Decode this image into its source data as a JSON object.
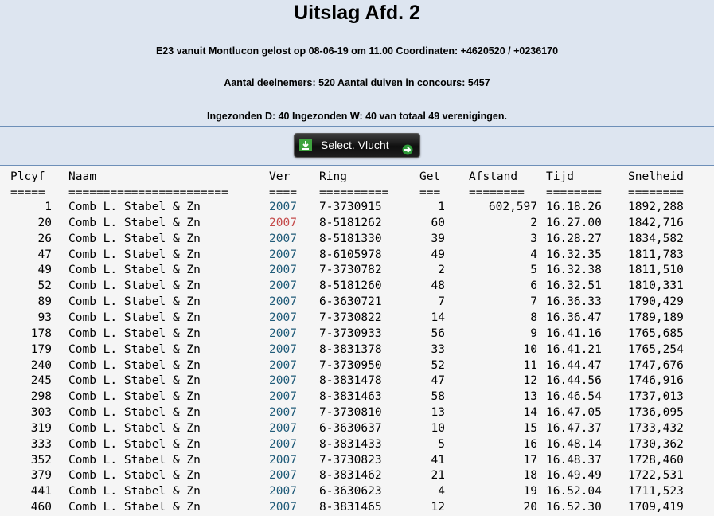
{
  "header": {
    "title": "Uitslag Afd. 2",
    "line1": "E23 vanuit Montlucon gelost op 08-06-19 om 11.00 Coordinaten: +4620520 / +0236170",
    "line2": "Aantal deelnemers: 520 Aantal duiven in concours: 5457",
    "line3": "Ingezonden D: 40 Ingezonden W: 40 van totaal 49 verenigingen."
  },
  "toolbar": {
    "select_label": "Select. Vlucht",
    "left_icon": "download-icon",
    "right_icon": "arrow-right-icon"
  },
  "table": {
    "headers": [
      "Plcyf",
      "Naam",
      "Ver",
      "Ring",
      "Get",
      "Afstand",
      "Tijd",
      "Snelheid"
    ],
    "separators": [
      "=====",
      "=======================",
      "====",
      "==========",
      "===",
      "========",
      "========",
      "========"
    ],
    "rows": [
      {
        "plcyf": "1",
        "naam": "Comb L. Stabel & Zn",
        "ver": "2007",
        "ring": "7-3730915",
        "get": "1",
        "afstand": "602,597",
        "tijd": "16.18.26",
        "snelheid": "1892,288",
        "ver_color": "#1e5a78"
      },
      {
        "plcyf": "20",
        "naam": "Comb L. Stabel & Zn",
        "ver": "2007",
        "ring": "8-5181262",
        "get": "60",
        "afstand": "2",
        "tijd": "16.27.00",
        "snelheid": "1842,716",
        "ver_color": "#c44a4a"
      },
      {
        "plcyf": "26",
        "naam": "Comb L. Stabel & Zn",
        "ver": "2007",
        "ring": "8-5181330",
        "get": "39",
        "afstand": "3",
        "tijd": "16.28.27",
        "snelheid": "1834,582",
        "ver_color": "#1e5a78"
      },
      {
        "plcyf": "47",
        "naam": "Comb L. Stabel & Zn",
        "ver": "2007",
        "ring": "8-6105978",
        "get": "49",
        "afstand": "4",
        "tijd": "16.32.35",
        "snelheid": "1811,783",
        "ver_color": "#1e5a78"
      },
      {
        "plcyf": "49",
        "naam": "Comb L. Stabel & Zn",
        "ver": "2007",
        "ring": "7-3730782",
        "get": "2",
        "afstand": "5",
        "tijd": "16.32.38",
        "snelheid": "1811,510",
        "ver_color": "#1e5a78"
      },
      {
        "plcyf": "52",
        "naam": "Comb L. Stabel & Zn",
        "ver": "2007",
        "ring": "8-5181260",
        "get": "48",
        "afstand": "6",
        "tijd": "16.32.51",
        "snelheid": "1810,331",
        "ver_color": "#1e5a78"
      },
      {
        "plcyf": "89",
        "naam": "Comb L. Stabel & Zn",
        "ver": "2007",
        "ring": "6-3630721",
        "get": "7",
        "afstand": "7",
        "tijd": "16.36.33",
        "snelheid": "1790,429",
        "ver_color": "#1e5a78"
      },
      {
        "plcyf": "93",
        "naam": "Comb L. Stabel & Zn",
        "ver": "2007",
        "ring": "7-3730822",
        "get": "14",
        "afstand": "8",
        "tijd": "16.36.47",
        "snelheid": "1789,189",
        "ver_color": "#1e5a78"
      },
      {
        "plcyf": "178",
        "naam": "Comb L. Stabel & Zn",
        "ver": "2007",
        "ring": "7-3730933",
        "get": "56",
        "afstand": "9",
        "tijd": "16.41.16",
        "snelheid": "1765,685",
        "ver_color": "#1e5a78"
      },
      {
        "plcyf": "179",
        "naam": "Comb L. Stabel & Zn",
        "ver": "2007",
        "ring": "8-3831378",
        "get": "33",
        "afstand": "10",
        "tijd": "16.41.21",
        "snelheid": "1765,254",
        "ver_color": "#1e5a78"
      },
      {
        "plcyf": "240",
        "naam": "Comb L. Stabel & Zn",
        "ver": "2007",
        "ring": "7-3730950",
        "get": "52",
        "afstand": "11",
        "tijd": "16.44.47",
        "snelheid": "1747,676",
        "ver_color": "#1e5a78"
      },
      {
        "plcyf": "245",
        "naam": "Comb L. Stabel & Zn",
        "ver": "2007",
        "ring": "8-3831478",
        "get": "47",
        "afstand": "12",
        "tijd": "16.44.56",
        "snelheid": "1746,916",
        "ver_color": "#1e5a78"
      },
      {
        "plcyf": "298",
        "naam": "Comb L. Stabel & Zn",
        "ver": "2007",
        "ring": "8-3831463",
        "get": "58",
        "afstand": "13",
        "tijd": "16.46.54",
        "snelheid": "1737,013",
        "ver_color": "#1e5a78"
      },
      {
        "plcyf": "303",
        "naam": "Comb L. Stabel & Zn",
        "ver": "2007",
        "ring": "7-3730810",
        "get": "13",
        "afstand": "14",
        "tijd": "16.47.05",
        "snelheid": "1736,095",
        "ver_color": "#1e5a78"
      },
      {
        "plcyf": "319",
        "naam": "Comb L. Stabel & Zn",
        "ver": "2007",
        "ring": "6-3630637",
        "get": "10",
        "afstand": "15",
        "tijd": "16.47.37",
        "snelheid": "1733,432",
        "ver_color": "#1e5a78"
      },
      {
        "plcyf": "333",
        "naam": "Comb L. Stabel & Zn",
        "ver": "2007",
        "ring": "8-3831433",
        "get": "5",
        "afstand": "16",
        "tijd": "16.48.14",
        "snelheid": "1730,362",
        "ver_color": "#1e5a78"
      },
      {
        "plcyf": "352",
        "naam": "Comb L. Stabel & Zn",
        "ver": "2007",
        "ring": "7-3730823",
        "get": "41",
        "afstand": "17",
        "tijd": "16.48.37",
        "snelheid": "1728,460",
        "ver_color": "#1e5a78"
      },
      {
        "plcyf": "379",
        "naam": "Comb L. Stabel & Zn",
        "ver": "2007",
        "ring": "8-3831462",
        "get": "21",
        "afstand": "18",
        "tijd": "16.49.49",
        "snelheid": "1722,531",
        "ver_color": "#1e5a78"
      },
      {
        "plcyf": "441",
        "naam": "Comb L. Stabel & Zn",
        "ver": "2007",
        "ring": "6-3630623",
        "get": "4",
        "afstand": "19",
        "tijd": "16.52.04",
        "snelheid": "1711,523",
        "ver_color": "#1e5a78"
      },
      {
        "plcyf": "460",
        "naam": "Comb L. Stabel & Zn",
        "ver": "2007",
        "ring": "8-3831465",
        "get": "12",
        "afstand": "20",
        "tijd": "16.52.30",
        "snelheid": "1709,419",
        "ver_color": "#1e5a78"
      }
    ]
  }
}
